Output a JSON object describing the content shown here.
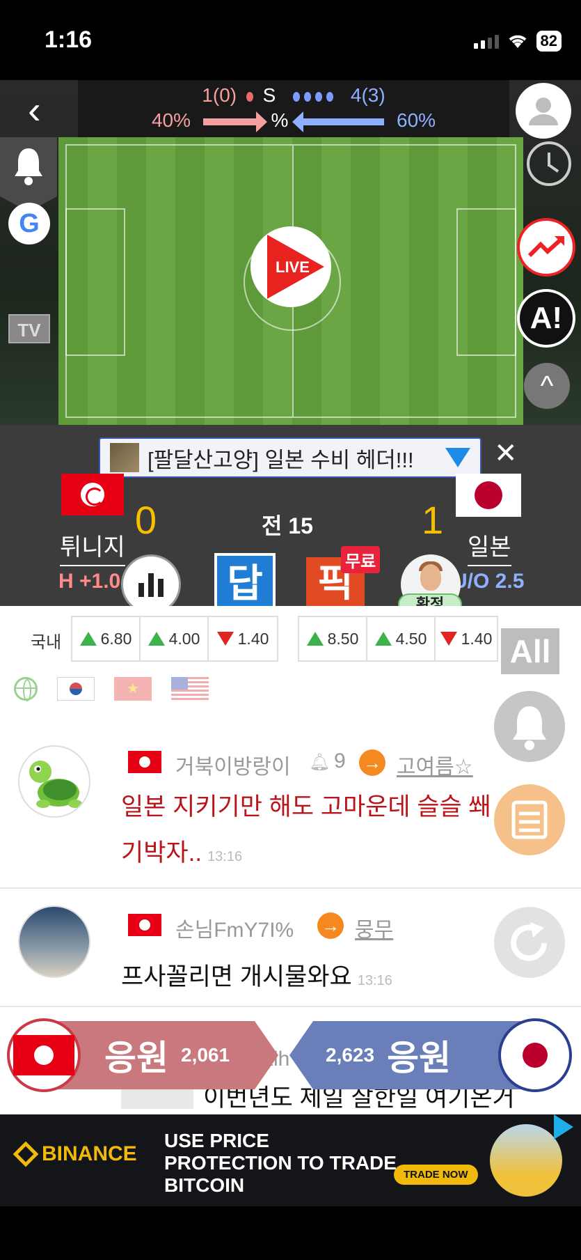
{
  "status_bar": {
    "time": "1:16",
    "battery": "82"
  },
  "scoreboard": {
    "home_shots": "1(0)",
    "shots_label": "S",
    "away_shots": "4(3)",
    "home_possession": "40%",
    "possession_label": "%",
    "away_possession": "60%"
  },
  "live_label": "LIVE",
  "tv_label": "TV",
  "ai_label": "A!",
  "google_label": "G",
  "ticker": {
    "text": "[팔달산고양] 일본 수비 헤더!!!"
  },
  "match": {
    "home_team": "튀니지",
    "away_team": "일본",
    "home_score": "0",
    "away_score": "1",
    "period": "전 15",
    "handicap": "H +1.0",
    "overunder": "U/O 2.5"
  },
  "actions": {
    "dap_label": "답",
    "pick_label": "픽",
    "free_badge": "무료",
    "confirm_label": "확정"
  },
  "odds": {
    "label": "국내",
    "group1": [
      {
        "dir": "up",
        "value": "6.80"
      },
      {
        "dir": "up",
        "value": "4.00"
      },
      {
        "dir": "down",
        "value": "1.40"
      }
    ],
    "group2": [
      {
        "dir": "up",
        "value": "8.50"
      },
      {
        "dir": "up",
        "value": "4.50"
      },
      {
        "dir": "down",
        "value": "1.40"
      }
    ],
    "all_label": "All",
    "overseas_label": "해외"
  },
  "comments": [
    {
      "author": "거북이방랑이",
      "likes": "9",
      "target": "고여름☆",
      "body": "일본 지키기만 해도 고마운데 슬슬 쐐기박자..",
      "time": "13:16"
    },
    {
      "author": "손님FmY7I%",
      "target": "뭉무",
      "body": "프사꼴리면 개시물와요",
      "time": "13:16"
    },
    {
      "author": "xih",
      "body": "이번년도 제일 잘한일 여기온거"
    }
  ],
  "cheer": {
    "home_label": "응원",
    "home_count": "2,061",
    "away_label": "응원",
    "away_count": "2,623"
  },
  "ad": {
    "brand": "BINANCE",
    "headline": "USE PRICE PROTECTION TO TRADE BITCOIN",
    "cta": "TRADE NOW"
  },
  "colors": {
    "home": "#e70013",
    "away": "#bc002d",
    "accent_orange": "#f5881f",
    "score_yellow": "#f6c000"
  }
}
